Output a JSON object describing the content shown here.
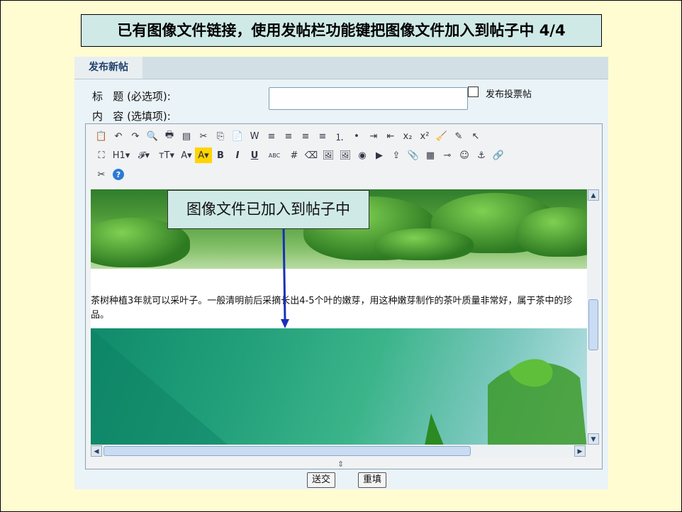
{
  "banner": {
    "text": "已有图像文件链接，使用发帖栏功能键把图像文件加入到帖子中 4/4"
  },
  "tab": {
    "label": "发布新帖"
  },
  "form": {
    "title_label": "标   题 (必选项):",
    "content_label": "内   容 (选填项):",
    "title_value": "",
    "poll_label": "发布投票帖"
  },
  "toolbar": {
    "row1": [
      "paste-icon",
      "undo-icon",
      "redo-icon",
      "preview-icon",
      "print-icon",
      "template-icon",
      "cut-icon",
      "copy-icon",
      "paste-text-icon",
      "paste-word-icon",
      "align-left-icon",
      "align-center-icon",
      "align-right-icon",
      "justify-icon",
      "ordered-list-icon",
      "unordered-list-icon",
      "indent-icon",
      "outdent-icon",
      "subscript-icon",
      "superscript-icon",
      "clear-format-icon",
      "edit-icon",
      "select-icon"
    ],
    "row1_glyphs": [
      "📋",
      "↶",
      "↷",
      "🔍",
      "🖶",
      "▤",
      "✂",
      "⎘",
      "📄",
      "W",
      "≡",
      "≡",
      "≡",
      "≡",
      "⒈",
      "•",
      "⇥",
      "⇤",
      "x₂",
      "x²",
      "🧹",
      "✎",
      "↖"
    ],
    "row2": [
      {
        "name": "fullscreen-icon",
        "glyph": "⛶"
      },
      {
        "name": "heading-button",
        "glyph": "H1▾"
      },
      {
        "name": "font-family-button",
        "glyph": "𝓕▾"
      },
      {
        "name": "font-size-button",
        "glyph": "тT▾"
      },
      {
        "name": "text-color-button",
        "glyph": "A▾"
      },
      {
        "name": "highlight-color-button",
        "glyph": "A▾"
      },
      {
        "name": "bold-button",
        "glyph": "B"
      },
      {
        "name": "italic-button",
        "glyph": "I"
      },
      {
        "name": "underline-button",
        "glyph": "U"
      },
      {
        "name": "strikethrough-button",
        "glyph": "ABC"
      },
      {
        "name": "hr-icon",
        "glyph": "#"
      },
      {
        "name": "eraser-icon",
        "glyph": "⌫"
      },
      {
        "name": "image-icon",
        "glyph": "🖼"
      },
      {
        "name": "multi-image-icon",
        "glyph": "🖼"
      },
      {
        "name": "flash-icon",
        "glyph": "◉"
      },
      {
        "name": "media-icon",
        "glyph": "▶"
      },
      {
        "name": "upload-icon",
        "glyph": "⇪"
      },
      {
        "name": "attachment-icon",
        "glyph": "📎"
      },
      {
        "name": "table-icon",
        "glyph": "▦"
      },
      {
        "name": "insert-hr-icon",
        "glyph": "⊸"
      },
      {
        "name": "emoticon-icon",
        "glyph": "☺"
      },
      {
        "name": "anchor-icon",
        "glyph": "⚓"
      },
      {
        "name": "link-icon",
        "glyph": "🔗"
      }
    ],
    "row3": [
      {
        "name": "unlink-icon",
        "glyph": "✂"
      },
      {
        "name": "help-icon",
        "glyph": "?"
      }
    ]
  },
  "editor": {
    "paragraph": "茶树种植3年就可以采叶子。一般清明前后采摘长出4-5个叶的嫩芽，用这种嫩芽制作的茶叶质量非常好，属于茶中的珍品。"
  },
  "buttons": {
    "submit": "送交",
    "reset": "重填"
  },
  "callout": {
    "text": "图像文件已加入到帖子中"
  },
  "colors": {
    "accent": "#1f3f6e",
    "arrow": "#1a2fb8",
    "banner_bg": "#cfe9e6"
  }
}
